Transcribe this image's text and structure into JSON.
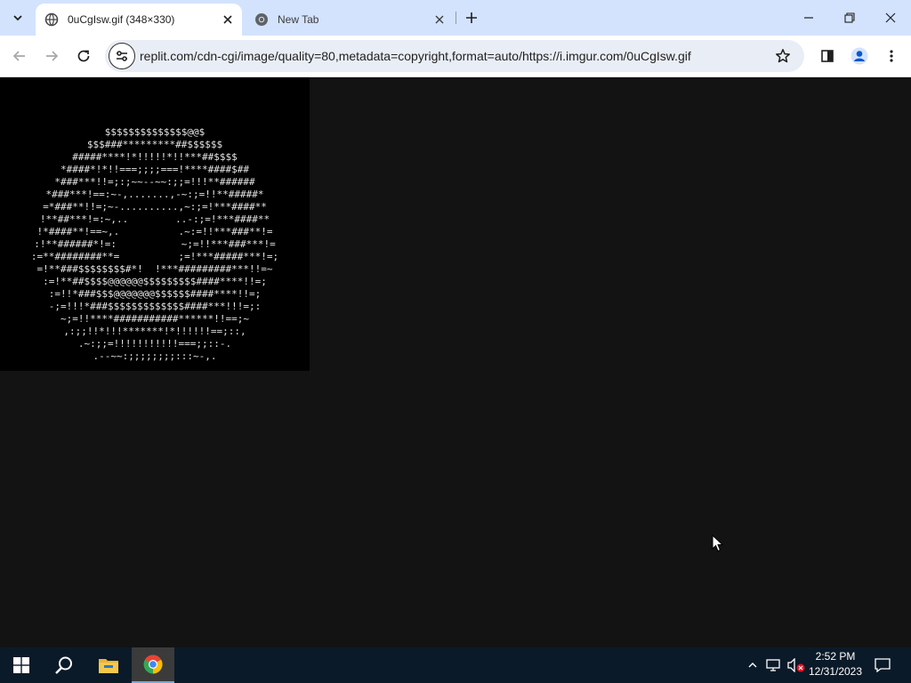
{
  "browser": {
    "tabs": [
      {
        "title": "0uCgIsw.gif (348×330)",
        "active": true,
        "favicon": "image-favicon-icon"
      },
      {
        "title": "New Tab",
        "active": false,
        "favicon": "chrome-favicon-icon"
      }
    ],
    "address": "replit.com/cdn-cgi/image/quality=80,metadata=copyright,format=auto/https://i.imgur.com/0uCgIsw.gif"
  },
  "content": {
    "image_natural_size": "348×330",
    "ascii_lines": [
      "$$$$$$$$$$$$$$@@$",
      "$$$###*********##$$$$$$",
      "#####****!*!!!!!*!!***##$$$$",
      "*####*!*!!===;;;;===!****####$##",
      "*###***!!=;:;~~--~~:;;=!!!**######",
      "*###***!==:~-,.......,-~:;=!!**#####*",
      "=*###**!!=;~-..........,~:;=!***####**",
      "!**##***!=:~,..        ..-:;=!***####**",
      "!*####**!==~,.          .~:=!!***###**!=",
      ":!**######*!=:           ~;=!!***###***!=",
      ":=**########**=          ;=!***#####***!=;",
      "=!**###$$$$$$$$#*!  !***#########***!!=~",
      ":=!**##$$$$@@@@@@$$$$$$$$$####****!!=;",
      ":=!!*###$$$@@@@@@@$$$$$$####****!!=;",
      "-;=!!!*###$$$$$$$$$$$$$####***!!!=;:",
      "~;=!!****###########******!!==;~",
      ",:;;!!*!!!*******!*!!!!!!==;::,",
      ".~:;;=!!!!!!!!!!!===;;::-.",
      ".--~~:;;;;;;;;:::~-,."
    ]
  },
  "taskbar": {
    "items": [
      {
        "name": "start-button",
        "icon": "windows-logo-icon"
      },
      {
        "name": "search-button",
        "icon": "search-icon"
      },
      {
        "name": "file-explorer-button",
        "icon": "folder-icon"
      },
      {
        "name": "chrome-button",
        "icon": "chrome-icon",
        "active": true
      }
    ],
    "time": "2:52 PM",
    "date": "12/31/2023"
  },
  "colors": {
    "tabstrip": "#d3e3fd",
    "page_background": "#131313",
    "image_background": "#000000",
    "taskbar": "#0b1a29"
  }
}
